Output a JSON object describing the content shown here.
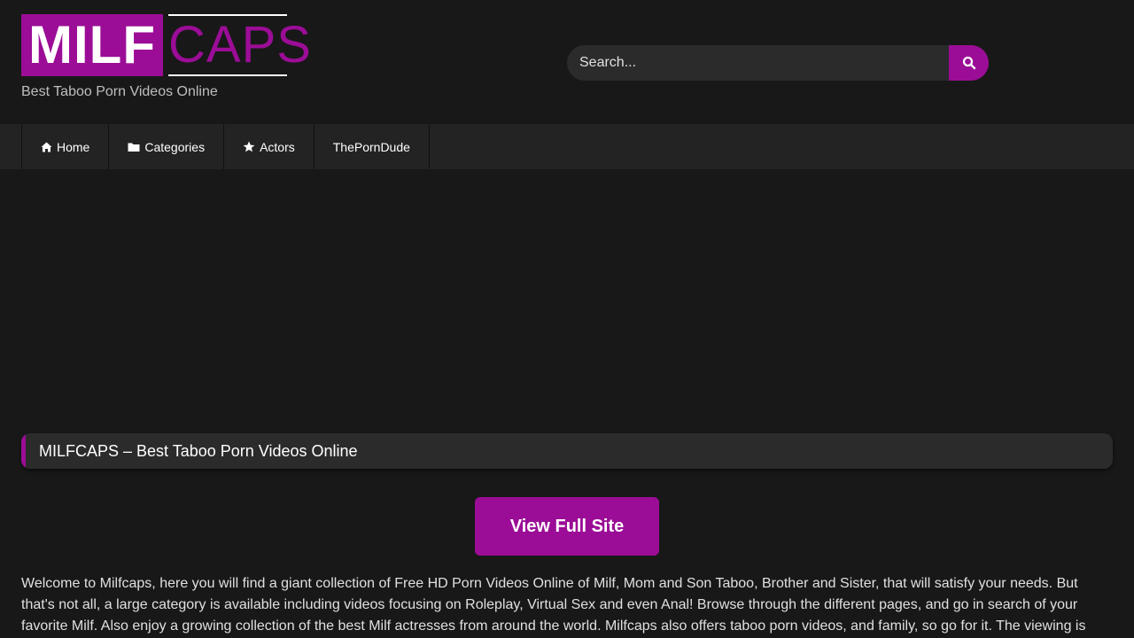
{
  "logo": {
    "part1": "MILF",
    "part2": "CAPS"
  },
  "tagline": "Best Taboo Porn Videos Online",
  "search": {
    "placeholder": "Search..."
  },
  "nav": [
    {
      "label": "Home",
      "icon": "home-icon"
    },
    {
      "label": "Categories",
      "icon": "folder-icon"
    },
    {
      "label": "Actors",
      "icon": "star-icon"
    },
    {
      "label": "ThePornDude"
    }
  ],
  "page_title": "MILFCAPS – Best Taboo Porn Videos Online",
  "view_button": "View Full Site",
  "intro_text": "Welcome to Milfcaps, here you will find a giant collection of Free HD Porn Videos Online of Milf, Mom and Son Taboo, Brother and Sister, that will satisfy your needs. But that's not all, a large category is available including videos focusing on Roleplay, Virtual Sex and even Anal! Browse through the different pages, and go in search of your favorite Milf. Also enjoy a growing collection of the best Milf actresses from around the world. Milfcaps also offers taboo porn videos, and family, so go for it. The viewing is",
  "colors": {
    "accent": "#9b0d96",
    "background": "#181818",
    "nav": "#232323",
    "panel": "#2b2b2b"
  }
}
